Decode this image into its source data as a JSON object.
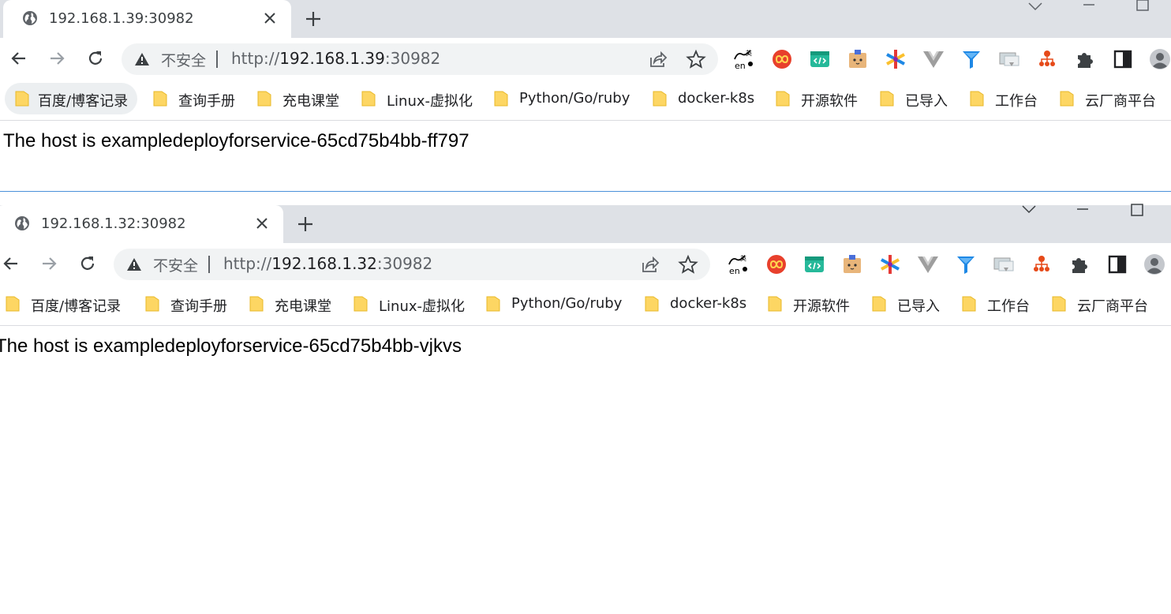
{
  "windows": [
    {
      "tab": {
        "title": "192.168.1.39:30982"
      },
      "omnibox": {
        "security_label": "不安全",
        "url_scheme": "http://",
        "url_host": "192.168.1.39",
        "url_port": ":30982"
      },
      "content": {
        "text": "The host is exampledeployforservice-65cd75b4bb-ff797"
      }
    },
    {
      "tab": {
        "title": "192.168.1.32:30982"
      },
      "omnibox": {
        "security_label": "不安全",
        "url_scheme": "http://",
        "url_host": "192.168.1.32",
        "url_port": ":30982"
      },
      "content": {
        "text": "The host is exampledeployforservice-65cd75b4bb-vjkvs"
      }
    }
  ],
  "bookmarks": [
    {
      "label": "百度/博客记录"
    },
    {
      "label": "查询手册"
    },
    {
      "label": "充电课堂"
    },
    {
      "label": "Linux-虚拟化"
    },
    {
      "label": "Python/Go/ruby"
    },
    {
      "label": "docker-k8s"
    },
    {
      "label": "开源软件"
    },
    {
      "label": "已导入"
    },
    {
      "label": "工作台"
    },
    {
      "label": "云厂商平台"
    }
  ],
  "extensions": [
    "translate-en-icon",
    "infinity-icon",
    "code-editor-icon",
    "cardboard-box-icon",
    "colorful-star-icon",
    "vue-devtools-icon",
    "funnel-icon",
    "screenshot-icon",
    "sitemap-icon",
    "puzzle-extensions-icon",
    "side-panel-icon",
    "profile-avatar-icon"
  ],
  "colors": {
    "tabbar_bg": "#dee1e6",
    "omnibox_bg": "#f1f3f4",
    "folder_yellow": "#fdd663",
    "separator_blue": "#4a90d9"
  }
}
